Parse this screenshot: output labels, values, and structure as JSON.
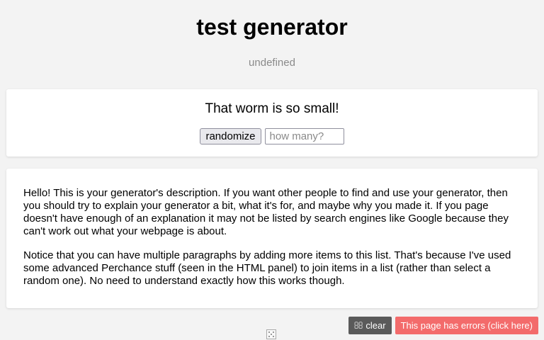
{
  "header": {
    "title": "test generator",
    "subtitle": "undefined"
  },
  "output": {
    "text": "That worm is so small!",
    "randomize_label": "randomize",
    "count_placeholder": "how many?"
  },
  "description": {
    "paragraphs": [
      "Hello! This is your generator's description. If you want other people to find and use your generator, then you should try to explain your generator a bit, what it's for, and maybe why you made it. If you page doesn't have enough of an explanation it may not be listed by search engines like Google because they can't work out what your webpage is about.",
      "Notice that you can have multiple paragraphs by adding more items to this list. That's because I've used some advanced Perchance stuff (seen in the HTML panel) to join items in a list (rather than select a random one). No need to understand exactly how this works though."
    ]
  },
  "footer": {
    "clear_icon": "",
    "clear_label": "clear",
    "errors_label": "This page has errors (click here)",
    "dice_icon": "dice-icon"
  },
  "colors": {
    "background": "#f3f3f3",
    "card": "#ffffff",
    "clear_button": "#5a5a5a",
    "errors_button": "#f36b6b",
    "subtitle": "#8a8a8a"
  }
}
